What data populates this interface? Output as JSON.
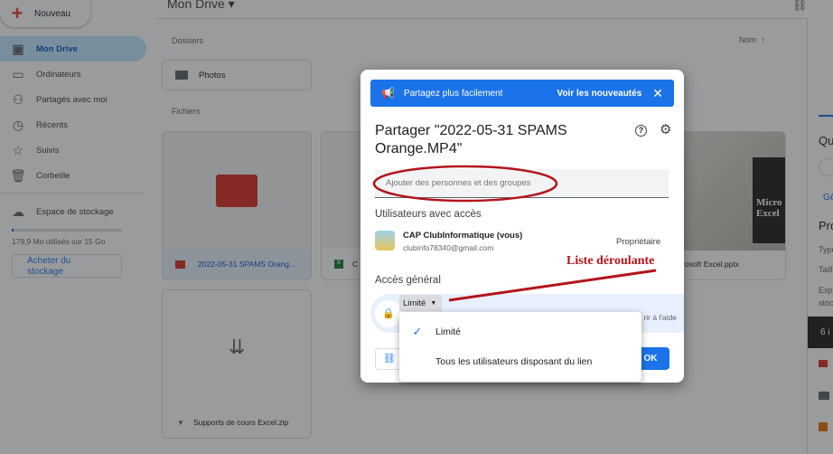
{
  "new_button": "Nouveau",
  "header": {
    "title": "Mon Drive",
    "sort_label": "Nom"
  },
  "sidebar": {
    "items": [
      {
        "label": "Mon Drive",
        "icon": "drive-icon"
      },
      {
        "label": "Ordinateurs",
        "icon": "computer-icon"
      },
      {
        "label": "Partagés avec moi",
        "icon": "shared-icon"
      },
      {
        "label": "Récents",
        "icon": "clock-icon"
      },
      {
        "label": "Suivis",
        "icon": "star-icon"
      },
      {
        "label": "Corbeille",
        "icon": "trash-icon"
      }
    ],
    "storage_label": "Espace de stockage",
    "storage_usage": "179,9 Mo utilisés sur 15 Go",
    "storage_fraction": 0.012,
    "buy_storage": "Acheter du stockage"
  },
  "sections": {
    "folders": "Dossiers",
    "files": "Fichiers"
  },
  "folders": [
    {
      "name": "Photos"
    }
  ],
  "files": [
    {
      "name": "2022-05-31 SPAMS Orang..."
    },
    {
      "name": "C"
    },
    {
      "name": "icrosoft Excel.pptx",
      "thumb_text": "Micro Excel"
    },
    {
      "name": "Supports de cours Excel.zip"
    }
  ],
  "details_panel": {
    "heading1": "Qu",
    "link": "Gé",
    "heading2": "Pro",
    "type": "Type",
    "size": "Taill",
    "storage": "Espa",
    "storage2": "stoc",
    "bar": "6 i"
  },
  "dialog": {
    "banner_text": "Partagez plus facilement",
    "banner_link": "Voir les nouveautés",
    "title": "Partager \"2022-05-31 SPAMS Orange.MP4\"",
    "add_placeholder": "Ajouter des personnes et des groupes",
    "users_heading": "Utilisateurs avec accès",
    "user": {
      "name": "CAP ClubInformatique (vous)",
      "email": "clubinfo78340@gmail.com",
      "role": "Propriétaire"
    },
    "general_access": "Accès général",
    "access_value": "Limité",
    "access_desc": "rir à l'aide",
    "ok": "OK",
    "menu": [
      {
        "label": "Limité",
        "selected": true
      },
      {
        "label": "Tous les utilisateurs disposant du lien",
        "selected": false
      }
    ]
  },
  "annotation": "Liste déroulante",
  "colors": {
    "accent": "#1a73e8",
    "annotation": "#b3141c",
    "video": "#d93025"
  }
}
